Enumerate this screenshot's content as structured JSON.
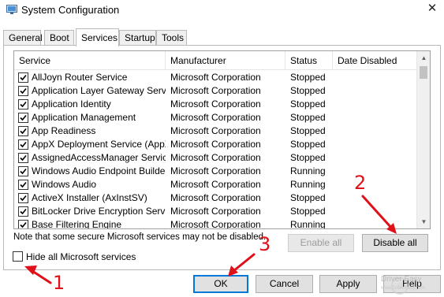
{
  "window": {
    "title": "System Configuration",
    "close_glyph": "✕"
  },
  "tabs": [
    {
      "label": "General"
    },
    {
      "label": "Boot"
    },
    {
      "label": "Services",
      "active": true
    },
    {
      "label": "Startup"
    },
    {
      "label": "Tools"
    }
  ],
  "columns": {
    "service": "Service",
    "manufacturer": "Manufacturer",
    "status": "Status",
    "date_disabled": "Date Disabled"
  },
  "services": [
    {
      "name": "AllJoyn Router Service",
      "manufacturer": "Microsoft Corporation",
      "status": "Stopped",
      "date": "",
      "checked": true
    },
    {
      "name": "Application Layer Gateway Service",
      "manufacturer": "Microsoft Corporation",
      "status": "Stopped",
      "date": "",
      "checked": true
    },
    {
      "name": "Application Identity",
      "manufacturer": "Microsoft Corporation",
      "status": "Stopped",
      "date": "",
      "checked": true
    },
    {
      "name": "Application Management",
      "manufacturer": "Microsoft Corporation",
      "status": "Stopped",
      "date": "",
      "checked": true
    },
    {
      "name": "App Readiness",
      "manufacturer": "Microsoft Corporation",
      "status": "Stopped",
      "date": "",
      "checked": true
    },
    {
      "name": "AppX Deployment Service (AppX…",
      "manufacturer": "Microsoft Corporation",
      "status": "Stopped",
      "date": "",
      "checked": true
    },
    {
      "name": "AssignedAccessManager Service",
      "manufacturer": "Microsoft Corporation",
      "status": "Stopped",
      "date": "",
      "checked": true
    },
    {
      "name": "Windows Audio Endpoint Builder",
      "manufacturer": "Microsoft Corporation",
      "status": "Running",
      "date": "",
      "checked": true
    },
    {
      "name": "Windows Audio",
      "manufacturer": "Microsoft Corporation",
      "status": "Running",
      "date": "",
      "checked": true
    },
    {
      "name": "ActiveX Installer (AxInstSV)",
      "manufacturer": "Microsoft Corporation",
      "status": "Stopped",
      "date": "",
      "checked": true
    },
    {
      "name": "BitLocker Drive Encryption Service",
      "manufacturer": "Microsoft Corporation",
      "status": "Stopped",
      "date": "",
      "checked": true
    },
    {
      "name": "Base Filtering Engine",
      "manufacturer": "Microsoft Corporation",
      "status": "Running",
      "date": "",
      "checked": true
    }
  ],
  "note": "Note that some secure Microsoft services may not be disabled.",
  "buttons": {
    "enable_all": "Enable all",
    "disable_all": "Disable all",
    "ok": "OK",
    "cancel": "Cancel",
    "apply": "Apply",
    "help": "Help"
  },
  "hide_ms_label": "Hide all Microsoft services",
  "hide_ms_checked": false,
  "annotations": [
    "1",
    "2",
    "3"
  ],
  "watermark": {
    "text": "Driver Easy",
    "subtext": "www.DriverEasy.com"
  },
  "colors": {
    "annotation": "#e0101a",
    "focus": "#0078d7"
  }
}
